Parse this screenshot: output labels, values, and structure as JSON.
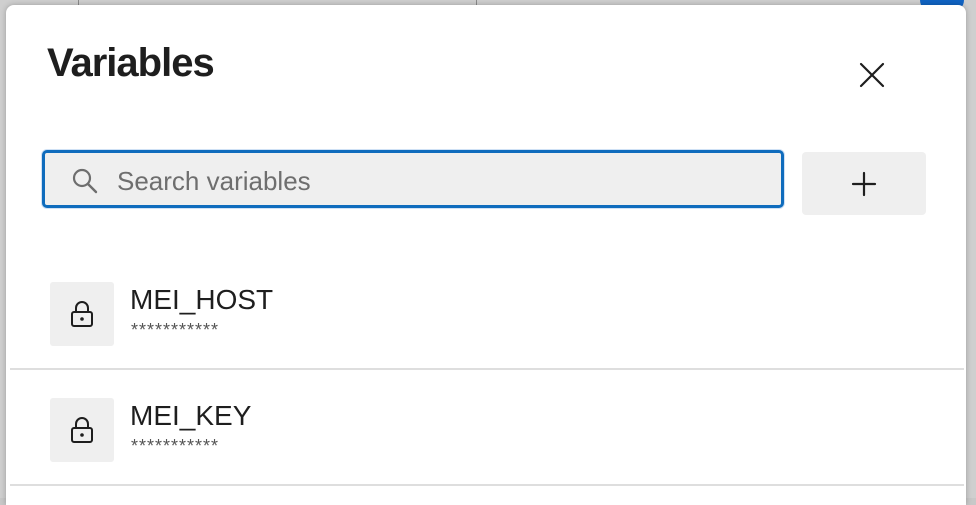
{
  "dialog": {
    "title": "Variables",
    "close_icon": "close-icon",
    "search": {
      "placeholder": "Search variables",
      "value": "",
      "icon": "search-icon"
    },
    "add_icon": "plus-icon",
    "variables": [
      {
        "name": "MEI_HOST",
        "value": "***********",
        "icon": "lock-icon"
      },
      {
        "name": "MEI_KEY",
        "value": "***********",
        "icon": "lock-icon"
      }
    ]
  },
  "colors": {
    "focus_border": "#0f6cbd",
    "field_bg": "#efefef",
    "text": "#1e1e1e"
  }
}
